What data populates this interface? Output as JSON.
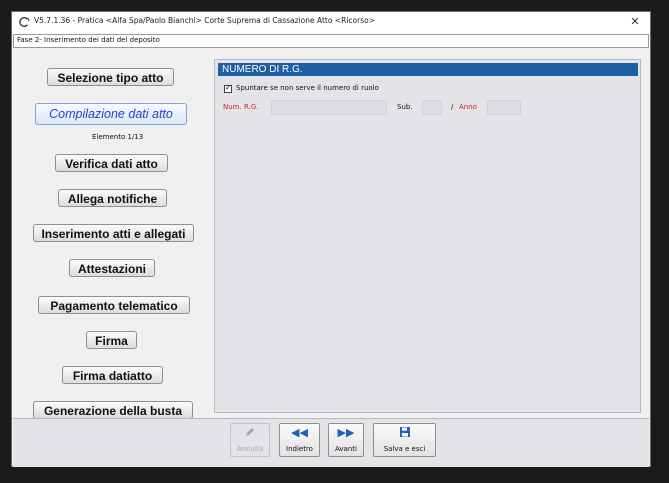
{
  "window": {
    "title": "V5.7.1.36 - Pratica <Alfa Spa/Paolo Bianchi>  Corte Suprema di Cassazione  Atto <Ricorso>",
    "close_label": "✕"
  },
  "phase": "Fase 2- Inserimento dei dati del deposito",
  "sidebar": {
    "items": [
      {
        "label": "Selezione tipo atto"
      },
      {
        "label": "Compilazione dati atto",
        "active": true
      },
      {
        "label": "Verifica dati atto"
      },
      {
        "label": "Allega notifiche"
      },
      {
        "label": "Inserimento atti e allegati"
      },
      {
        "label": "Attestazioni"
      },
      {
        "label": "Pagamento telematico"
      },
      {
        "label": "Firma"
      },
      {
        "label": "Firma datiatto"
      },
      {
        "label": "Generazione della busta"
      }
    ],
    "element_counter": "Elemento 1/13"
  },
  "form": {
    "section_title": "NUMERO DI R.G.",
    "checkbox_label": "Spuntare se non serve il numero di ruolo",
    "checkbox_checked": true,
    "num_rg_label": "Num. R.G.",
    "num_rg_value": "",
    "sub_label": "Sub.",
    "sub_value": "",
    "slash": "/",
    "anno_label": "Anno",
    "anno_value": ""
  },
  "toolbar": {
    "annulla": {
      "label": "Annulla",
      "icon": "pencil-icon",
      "enabled": false
    },
    "indietro": {
      "label": "Indietro",
      "icon": "rewind-icon"
    },
    "avanti": {
      "label": "Avanti",
      "icon": "fast-forward-icon"
    },
    "salva": {
      "label": "Salva e esci",
      "icon": "floppy-disk-icon"
    }
  },
  "colors": {
    "section_header": "#1e5ea3",
    "required_label": "#d62020",
    "active_nav_text": "#2a3cd6"
  }
}
